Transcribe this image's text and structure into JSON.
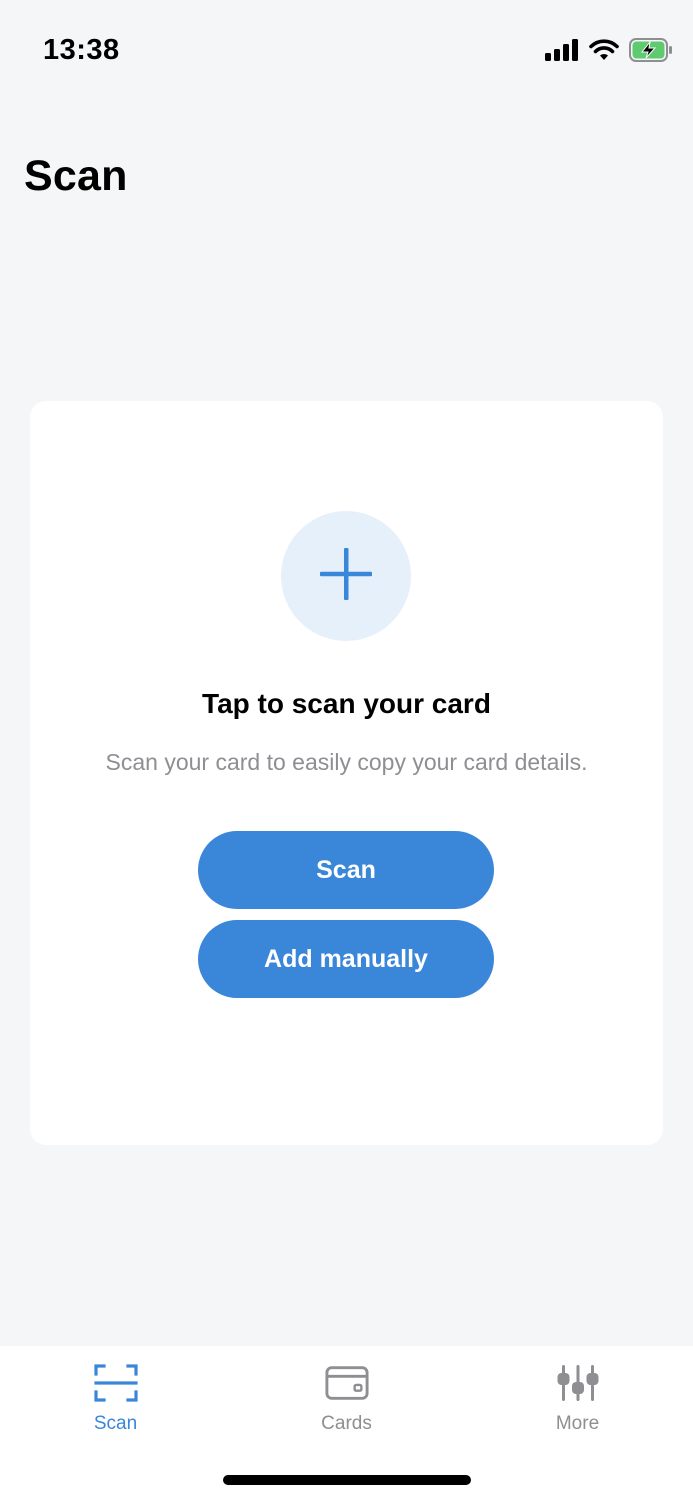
{
  "status_bar": {
    "time": "13:38",
    "icons": [
      "signal-icon",
      "wifi-icon",
      "battery-charging-icon"
    ]
  },
  "page": {
    "title": "Scan"
  },
  "card": {
    "icon": "plus-icon",
    "heading": "Tap to scan your card",
    "subtitle": "Scan your card to easily copy your card details.",
    "scan_button": "Scan",
    "manual_button": "Add manually"
  },
  "tabs": [
    {
      "label": "Scan",
      "icon": "scan-frame-icon",
      "active": true
    },
    {
      "label": "Cards",
      "icon": "wallet-icon",
      "active": false
    },
    {
      "label": "More",
      "icon": "sliders-icon",
      "active": false
    }
  ],
  "colors": {
    "accent": "#3a86d9",
    "accent_light": "#e6f0fb",
    "background": "#f5f6f8",
    "inactive": "#8e8e93",
    "battery_green": "#5ecb6e"
  }
}
